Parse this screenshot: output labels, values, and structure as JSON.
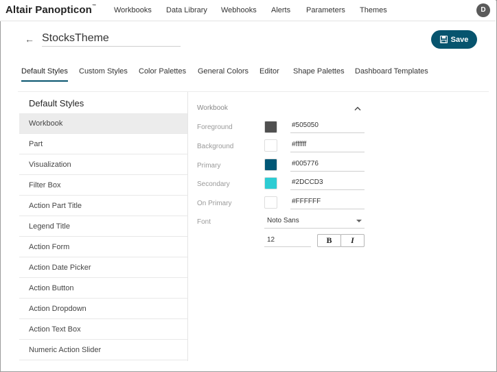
{
  "nav": {
    "brand": "Altair Panopticon",
    "brand_mark": "™",
    "items": [
      "Workbooks",
      "Data Library",
      "Webhooks",
      "Alerts",
      "Parameters",
      "Themes"
    ],
    "avatar_initial": "D"
  },
  "header": {
    "back_icon": "arrow-left-icon",
    "title": "StocksTheme",
    "save_label": "Save",
    "save_icon": "floppy-disk-icon"
  },
  "tabs": [
    "Default Styles",
    "Custom Styles",
    "Color Palettes",
    "General Colors",
    "Editor",
    "Shape Palettes",
    "Dashboard Templates"
  ],
  "active_tab": "Default Styles",
  "sidebar": {
    "title": "Default Styles",
    "items": [
      "Workbook",
      "Part",
      "Visualization",
      "Filter Box",
      "Action Part Title",
      "Legend Title",
      "Action Form",
      "Action Date Picker",
      "Action Button",
      "Action Dropdown",
      "Action Text Box",
      "Numeric Action Slider"
    ],
    "selected": "Workbook"
  },
  "workbook": {
    "section_title": "Workbook",
    "colors": [
      {
        "label": "Foreground",
        "value": "#505050",
        "swatch": "#505050"
      },
      {
        "label": "Background",
        "value": "#ffffff",
        "swatch": "#ffffff"
      },
      {
        "label": "Primary",
        "value": "#005776",
        "swatch": "#005776"
      },
      {
        "label": "Secondary",
        "value": "#2DCCD3",
        "swatch": "#2DCCD3"
      },
      {
        "label": "On Primary",
        "value": "#FFFFFF",
        "swatch": "#FFFFFF"
      }
    ],
    "font_label": "Font",
    "font_value": "Noto Sans",
    "font_size": "12",
    "bold_label": "B",
    "italic_label": "I"
  },
  "accent": "#07546e"
}
